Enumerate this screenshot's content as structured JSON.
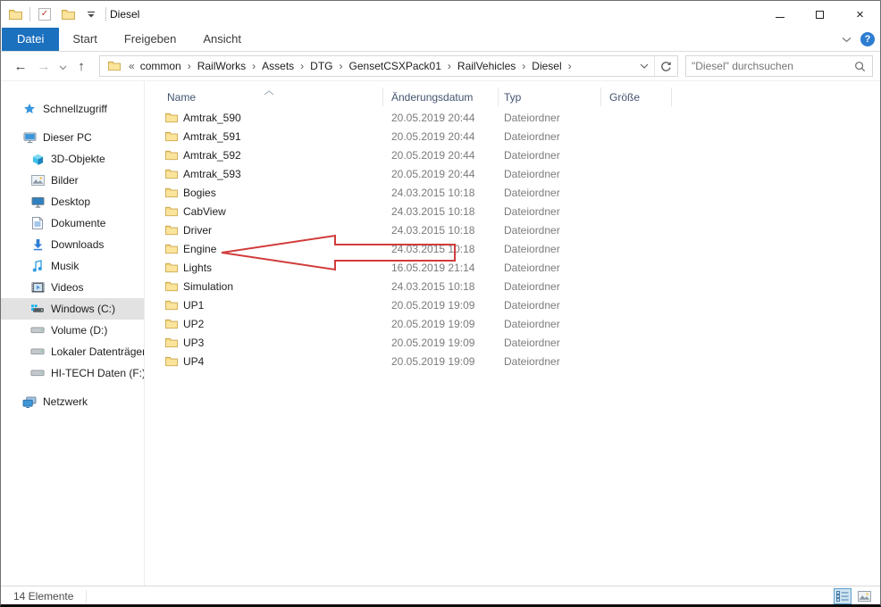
{
  "window": {
    "title": "Diesel"
  },
  "titlebar": {
    "minimize_glyph": "",
    "close_glyph": "×"
  },
  "tabs": {
    "active": "Datei",
    "items": [
      "Start",
      "Freigeben",
      "Ansicht"
    ]
  },
  "breadcrumb": {
    "overflow": "«",
    "items": [
      "common",
      "RailWorks",
      "Assets",
      "DTG",
      "GensetCSXPack01",
      "RailVehicles",
      "Diesel"
    ],
    "separator": "›"
  },
  "search": {
    "placeholder": "\"Diesel\" durchsuchen"
  },
  "sidebar": {
    "items": [
      {
        "label": "Schnellzugriff"
      },
      {
        "label": "Dieser PC"
      },
      {
        "label": "3D-Objekte"
      },
      {
        "label": "Bilder"
      },
      {
        "label": "Desktop"
      },
      {
        "label": "Dokumente"
      },
      {
        "label": "Downloads"
      },
      {
        "label": "Musik"
      },
      {
        "label": "Videos"
      },
      {
        "label": "Windows (C:)"
      },
      {
        "label": "Volume (D:)"
      },
      {
        "label": "Lokaler Datenträger"
      },
      {
        "label": "HI-TECH Daten (F:)"
      },
      {
        "label": "Netzwerk"
      }
    ],
    "selected": "Windows (C:)"
  },
  "files": {
    "columns": [
      "Name",
      "Änderungsdatum",
      "Typ",
      "Größe"
    ],
    "rows": [
      {
        "name": "Amtrak_590",
        "date": "20.05.2019 20:44",
        "type": "Dateiordner"
      },
      {
        "name": "Amtrak_591",
        "date": "20.05.2019 20:44",
        "type": "Dateiordner"
      },
      {
        "name": "Amtrak_592",
        "date": "20.05.2019 20:44",
        "type": "Dateiordner"
      },
      {
        "name": "Amtrak_593",
        "date": "20.05.2019 20:44",
        "type": "Dateiordner"
      },
      {
        "name": "Bogies",
        "date": "24.03.2015 10:18",
        "type": "Dateiordner"
      },
      {
        "name": "CabView",
        "date": "24.03.2015 10:18",
        "type": "Dateiordner"
      },
      {
        "name": "Driver",
        "date": "24.03.2015 10:18",
        "type": "Dateiordner"
      },
      {
        "name": "Engine",
        "date": "24.03.2015 10:18",
        "type": "Dateiordner"
      },
      {
        "name": "Lights",
        "date": "16.05.2019 21:14",
        "type": "Dateiordner"
      },
      {
        "name": "Simulation",
        "date": "24.03.2015 10:18",
        "type": "Dateiordner"
      },
      {
        "name": "UP1",
        "date": "20.05.2019 19:09",
        "type": "Dateiordner"
      },
      {
        "name": "UP2",
        "date": "20.05.2019 19:09",
        "type": "Dateiordner"
      },
      {
        "name": "UP3",
        "date": "20.05.2019 19:09",
        "type": "Dateiordner"
      },
      {
        "name": "UP4",
        "date": "20.05.2019 19:09",
        "type": "Dateiordner"
      }
    ]
  },
  "status": {
    "count": "14 Elemente"
  },
  "annotation": {
    "type": "arrow",
    "points_to": "Engine",
    "color": "#d23b3b"
  }
}
